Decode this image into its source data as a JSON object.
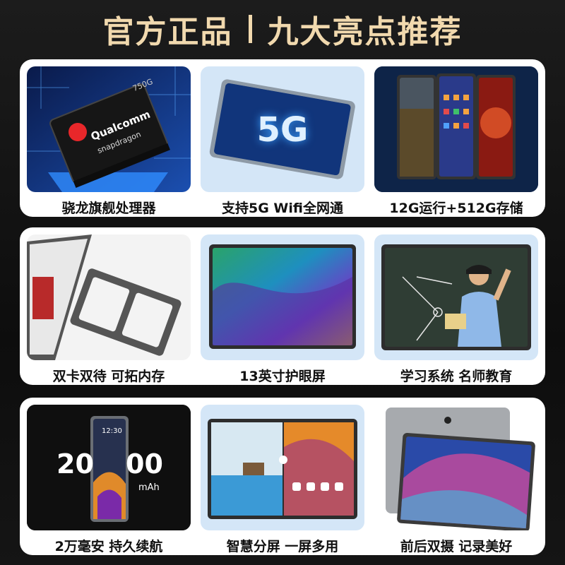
{
  "title": {
    "left": "官方正品",
    "right": "九大亮点推荐"
  },
  "features": [
    {
      "caption": "骁龙旗舰处理器",
      "chip_brand": "Qualcomm",
      "chip_sub": "snapdragon",
      "chip_model": "750G"
    },
    {
      "caption": "支持5G Wifi全网通",
      "badge": "5G"
    },
    {
      "caption": "12G运行+512G存储"
    },
    {
      "caption": "双卡双待 可拓内存"
    },
    {
      "caption": "13英寸护眼屏"
    },
    {
      "caption": "学习系统 名师教育"
    },
    {
      "caption": "2万毫安 持久续航",
      "battery_left": "20",
      "battery_right": "00",
      "battery_unit": "mAh",
      "screen_time": "12:30"
    },
    {
      "caption": "智慧分屏 一屏多用"
    },
    {
      "caption": "前后双摄 记录美好"
    }
  ],
  "colors": {
    "title": "#f1d9ae",
    "panel": "#ffffff",
    "card_blue": "#d4e6f7",
    "chip_glow": "#2f8cff"
  }
}
